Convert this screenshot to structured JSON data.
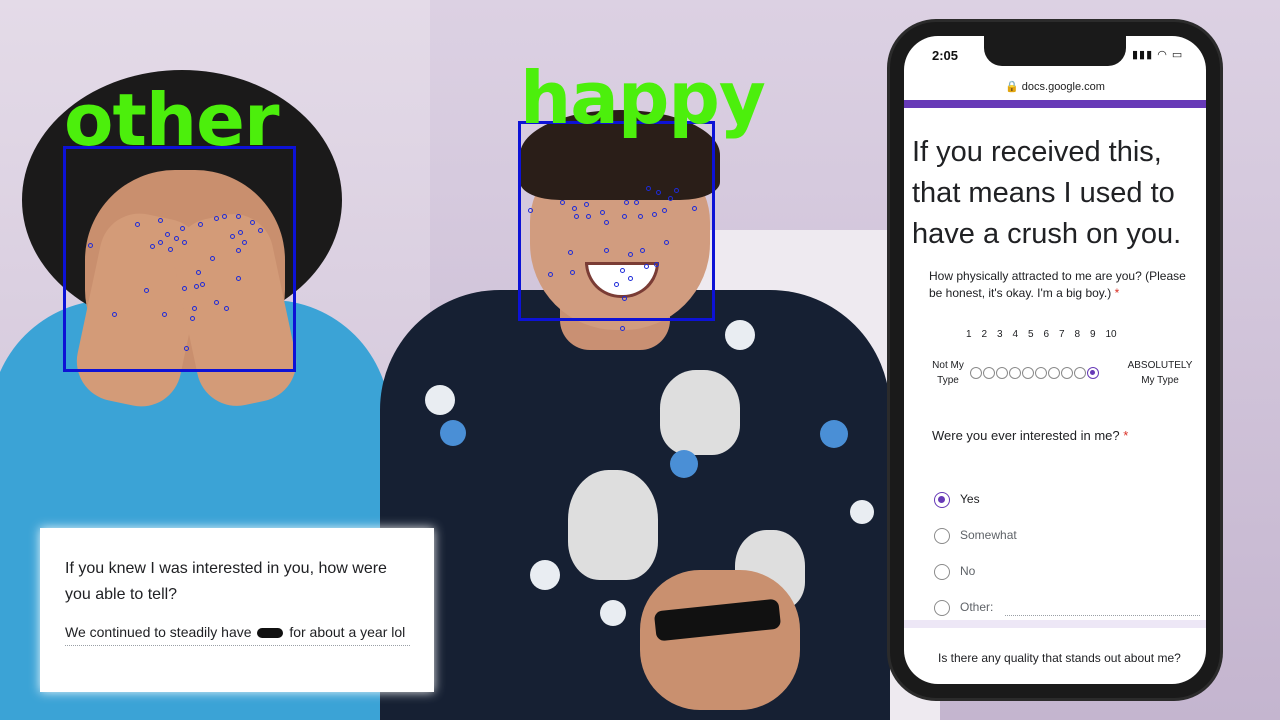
{
  "image": {
    "description": "Two young men reacting to a Google Forms survey on a phone, with face-emotion detection overlays",
    "colors": {
      "emotion_label": "#4cef0c",
      "face_box": "#0d12d6",
      "form_accent": "#673ab7"
    }
  },
  "overlays": {
    "left_face": {
      "emotion": "other"
    },
    "right_face": {
      "emotion": "happy"
    }
  },
  "response_card": {
    "question": "If you knew I was interested in you, how were you able to tell?",
    "answer_before": "We continued to steadily have",
    "answer_after": "for about a year lol"
  },
  "phone": {
    "time": "2:05",
    "status_icons": "▮▮▮ ◠ ▭",
    "url": "🔒 docs.google.com",
    "form": {
      "title": "If you received this, that means I used to have a crush on you.",
      "q1": {
        "text": "How physically attracted to me are you? (Please be honest, it's okay. I'm a big boy.)",
        "required_mark": "*",
        "scale_numbers": [
          "1",
          "2",
          "3",
          "4",
          "5",
          "6",
          "7",
          "8",
          "9",
          "10"
        ],
        "low_label": "Not My Type",
        "high_label": "ABSOLUTELY My Type",
        "selected": 10
      },
      "q2": {
        "text": "Were you ever interested in me?",
        "required_mark": "*",
        "options": [
          "Yes",
          "Somewhat",
          "No",
          "Other:"
        ],
        "selected": "Yes"
      },
      "q3": {
        "text": "Is there any quality that stands out about me?"
      }
    }
  }
}
